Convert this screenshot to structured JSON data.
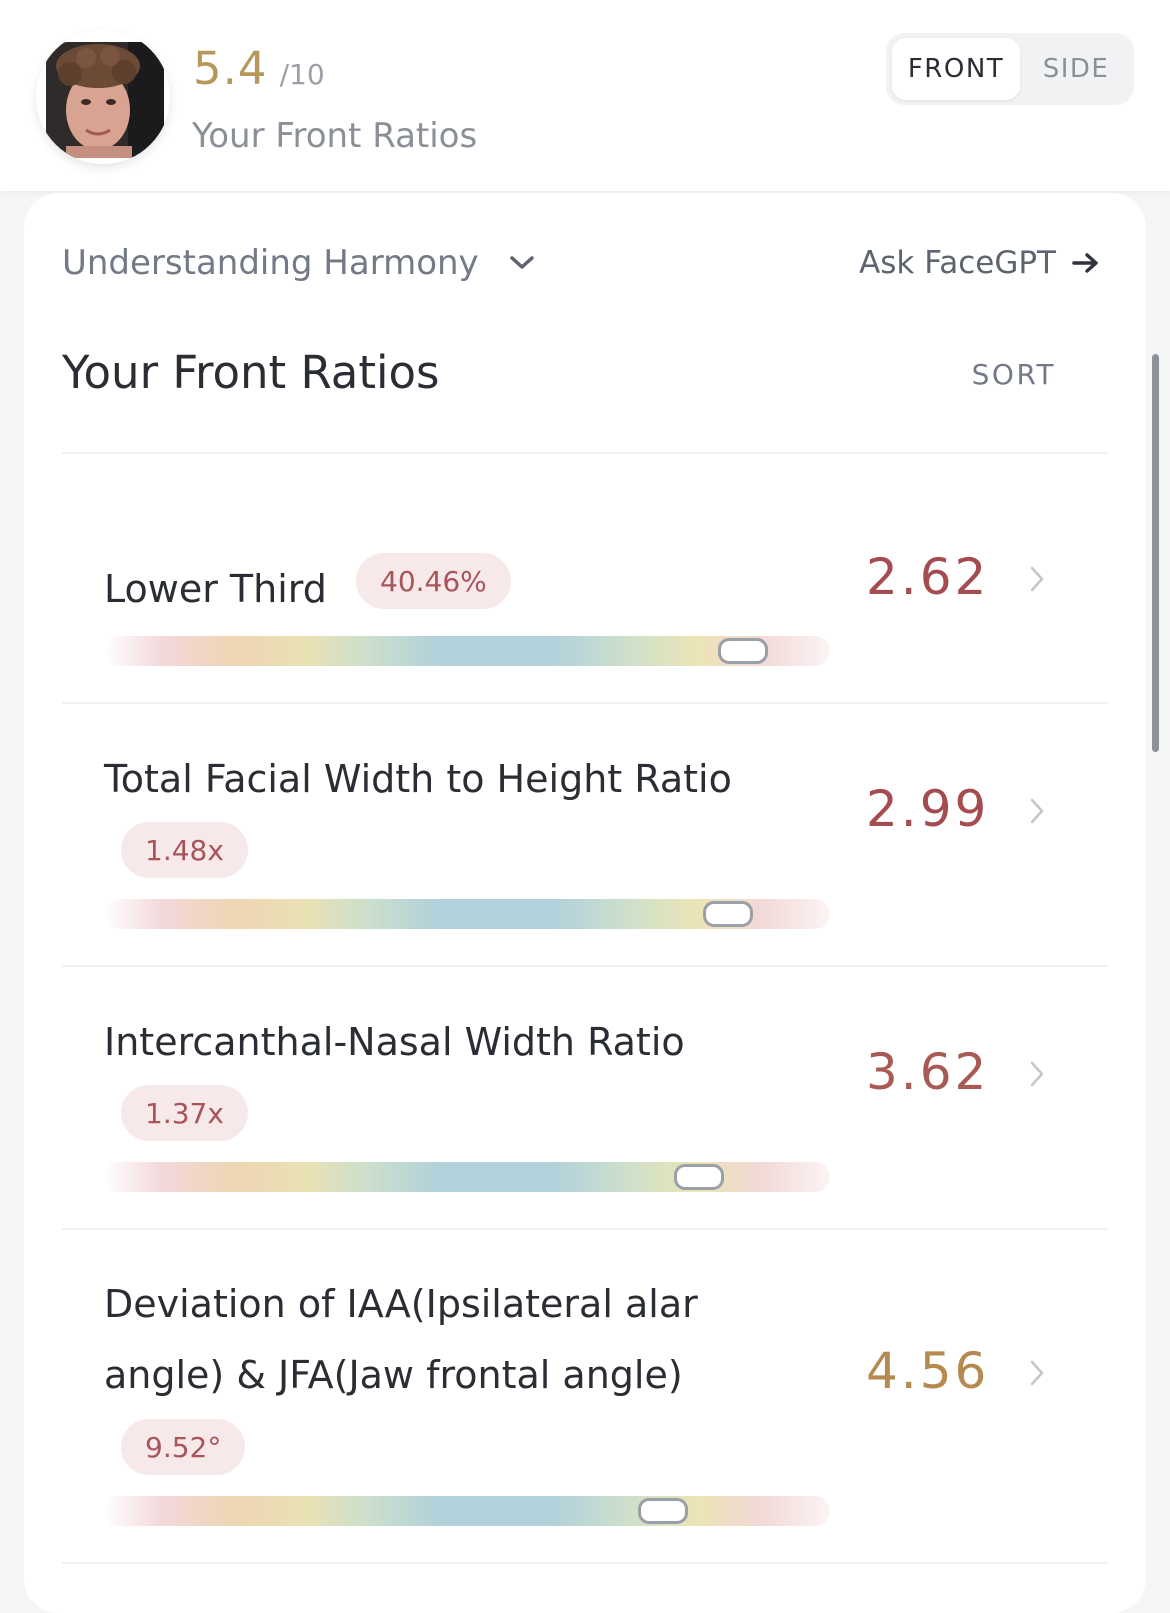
{
  "header": {
    "score": "5.4",
    "score_max": "/10",
    "subtitle": "Your Front Ratios",
    "toggle": {
      "front_label": "FRONT",
      "side_label": "SIDE",
      "selected": "FRONT"
    }
  },
  "toolbar": {
    "understanding_label": "Understanding Harmony",
    "ask_label": "Ask FaceGPT"
  },
  "section": {
    "title": "Your Front Ratios",
    "sort_label": "SORT"
  },
  "colors": {
    "score_gold": "#b6985a",
    "value_red": "#a44c50",
    "value_gold": "#b68a4e",
    "badge_bg": "#f7e9ea",
    "badge_text": "#a8555a"
  },
  "ratios": [
    {
      "title": "Lower Third",
      "badge": "40.46%",
      "value": "2.62",
      "position": 0.88
    },
    {
      "title": "Total Facial Width to Height Ratio",
      "badge": "1.48x",
      "value": "2.99",
      "position": 0.86
    },
    {
      "title": "Intercanthal-Nasal Width Ratio",
      "badge": "1.37x",
      "value": "3.62",
      "position": 0.82
    },
    {
      "title_line1": "Deviation of IAA(Ipsilateral alar",
      "title_line2": "angle) & JFA(Jaw frontal angle)",
      "badge": "9.52°",
      "value": "4.56",
      "position": 0.77
    }
  ],
  "icons": {
    "dropdown": "chevron-down-icon",
    "arrow": "arrow-right-icon",
    "row_chevron": "chevron-right-icon"
  }
}
